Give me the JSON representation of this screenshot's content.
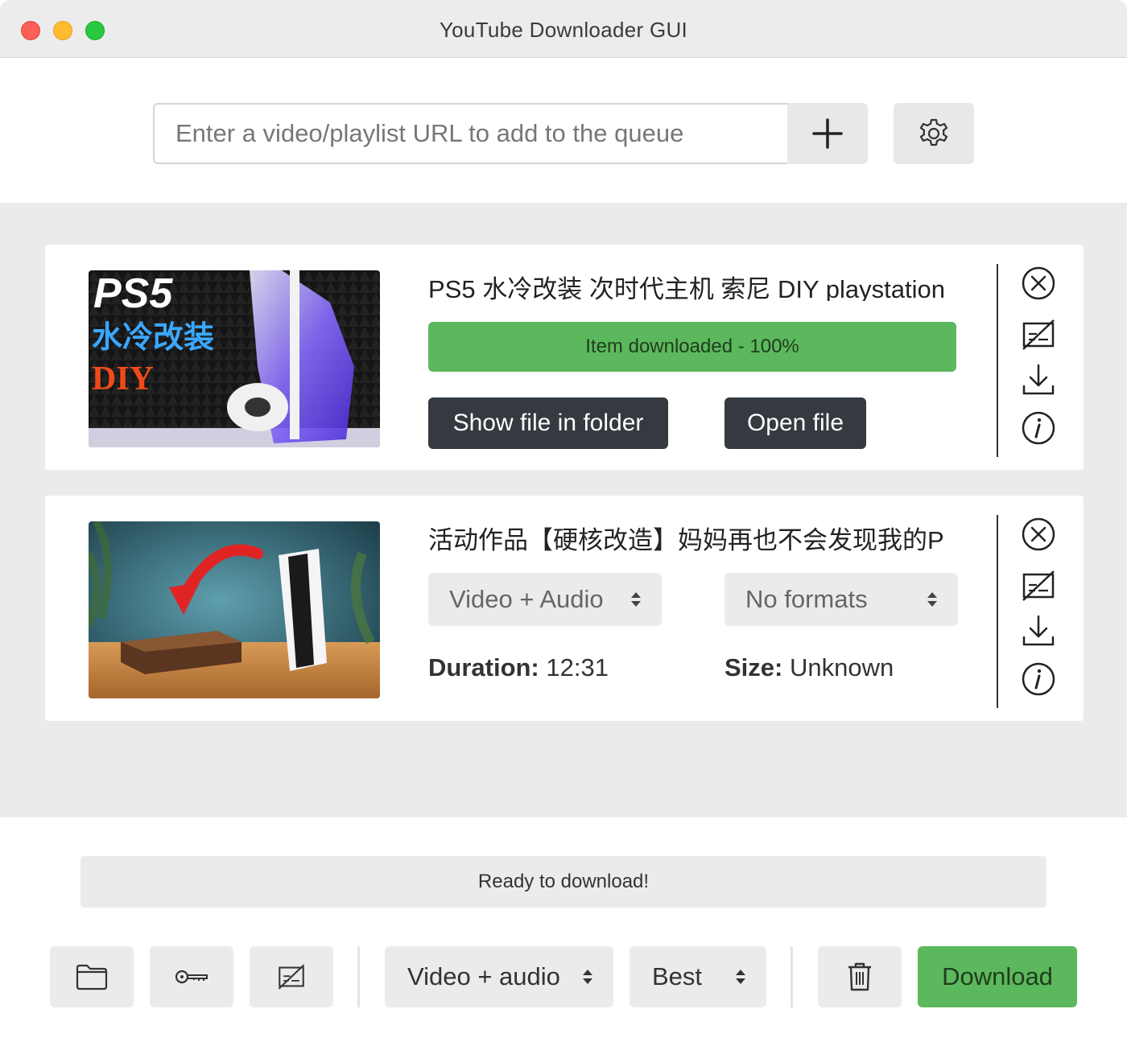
{
  "window": {
    "title": "YouTube Downloader GUI"
  },
  "url_bar": {
    "placeholder": "Enter a video/playlist URL to add to the queue"
  },
  "queue": [
    {
      "title": "PS5 水冷改装 次时代主机 索尼 DIY playstation",
      "thumbnail_text": {
        "line1": "PS5",
        "line2": "水冷改装",
        "line3": "DIY"
      },
      "progress_label": "Item downloaded - 100%",
      "progress": 1.0,
      "show_folder_label": "Show file in folder",
      "open_file_label": "Open file"
    },
    {
      "title": "活动作品【硬核改造】妈妈再也不会发现我的P",
      "type_select": "Video + Audio",
      "format_select": "No formats",
      "duration_label": "Duration:",
      "duration_value": "12:31",
      "size_label": "Size:",
      "size_value": "Unknown"
    }
  ],
  "status": {
    "text": "Ready to download!"
  },
  "toolbar": {
    "type_select": "Video + audio",
    "quality_select": "Best",
    "download_label": "Download"
  },
  "icons": {
    "add": "plus-icon",
    "settings": "gear-icon",
    "remove": "close-circle-icon",
    "subtitles_off": "subtitles-off-icon",
    "download": "download-icon",
    "info": "info-icon",
    "folder": "folder-icon",
    "key": "key-icon",
    "trash": "trash-icon"
  },
  "colors": {
    "success": "#5cb85c",
    "dark_button": "#343a40",
    "panel_bg": "#ebebeb",
    "traffic_red": "#fe5f57",
    "traffic_yellow": "#febc2e",
    "traffic_green": "#28c840"
  }
}
